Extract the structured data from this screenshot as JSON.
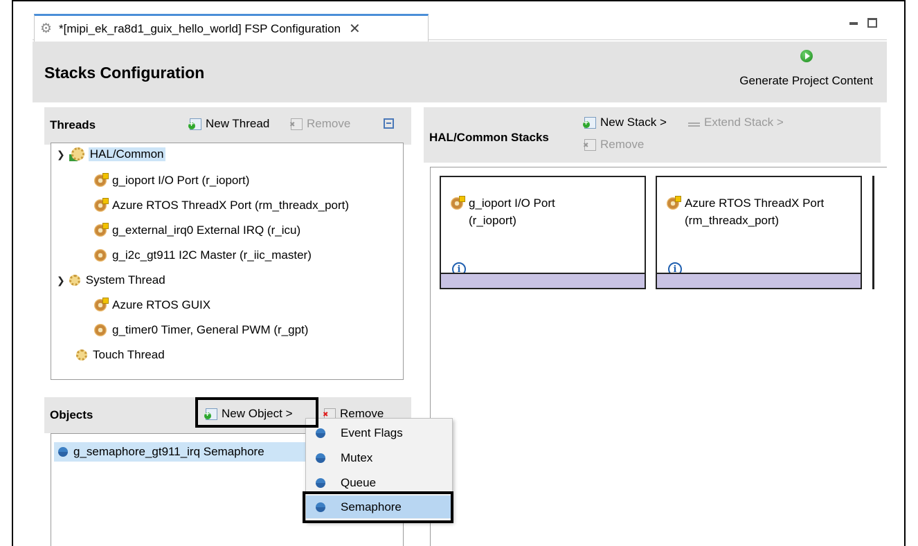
{
  "tab": {
    "title": "*[mipi_ek_ra8d1_guix_hello_world] FSP Configuration",
    "close_glyph": "✕"
  },
  "header": {
    "title": "Stacks Configuration",
    "generate_label": "Generate Project Content"
  },
  "threads": {
    "title": "Threads",
    "new_thread_label": "New Thread",
    "remove_label": "Remove",
    "tree": [
      {
        "label": "HAL/Common",
        "icon": "hal-common-icon",
        "expanded": true
      },
      {
        "label": "g_ioport I/O Port (r_ioport)",
        "icon": "module-icon"
      },
      {
        "label": "Azure RTOS ThreadX Port (rm_threadx_port)",
        "icon": "module-icon"
      },
      {
        "label": "g_external_irq0 External IRQ (r_icu)",
        "icon": "module-icon"
      },
      {
        "label": "g_i2c_gt911 I2C Master (r_iic_master)",
        "icon": "module-icon"
      },
      {
        "label": "System Thread",
        "icon": "thread-icon",
        "expanded": true
      },
      {
        "label": "Azure RTOS GUIX",
        "icon": "module-icon"
      },
      {
        "label": "g_timer0 Timer, General PWM (r_gpt)",
        "icon": "module-icon"
      },
      {
        "label": "Touch Thread",
        "icon": "thread-icon"
      }
    ]
  },
  "objects": {
    "title": "Objects",
    "new_object_label": "New Object >",
    "remove_label": "Remove",
    "items": [
      {
        "label": "g_semaphore_gt911_irq Semaphore",
        "selected": true
      }
    ]
  },
  "stacks": {
    "title": "HAL/Common Stacks",
    "new_stack_label": "New Stack >",
    "extend_stack_label": "Extend Stack >",
    "remove_label": "Remove",
    "cards": [
      {
        "line1": "g_ioport I/O Port",
        "line2": "(r_ioport)"
      },
      {
        "line1": "Azure RTOS ThreadX Port",
        "line2": "(rm_threadx_port)"
      }
    ],
    "info_glyph": "i"
  },
  "new_object_menu": {
    "items": [
      {
        "label": "Event Flags",
        "highlighted": false
      },
      {
        "label": "Mutex",
        "highlighted": false
      },
      {
        "label": "Queue",
        "highlighted": false
      },
      {
        "label": "Semaphore",
        "highlighted": true
      }
    ]
  },
  "colors": {
    "tab_accent": "#4a8ed8",
    "header_bg": "#e3e3e3",
    "card_footer": "#c9c3e4",
    "selection": "#cce4f7",
    "menu_highlight": "#b8d6f2"
  }
}
